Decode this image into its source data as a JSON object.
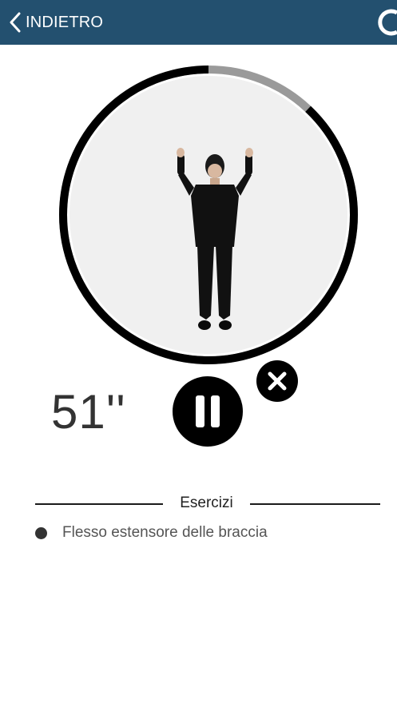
{
  "header": {
    "back_label": "INDIETRO",
    "back_icon": "chevron-left-icon",
    "right_icon": "refresh-icon",
    "background_color": "#23506f"
  },
  "workout": {
    "progress_remaining_fraction": 0.88,
    "timer": "51''",
    "pause_icon": "pause-icon",
    "close_icon": "close-icon"
  },
  "exercises_section": {
    "title": "Esercizi",
    "items": [
      {
        "label": "Flesso estensore delle braccia"
      }
    ]
  }
}
